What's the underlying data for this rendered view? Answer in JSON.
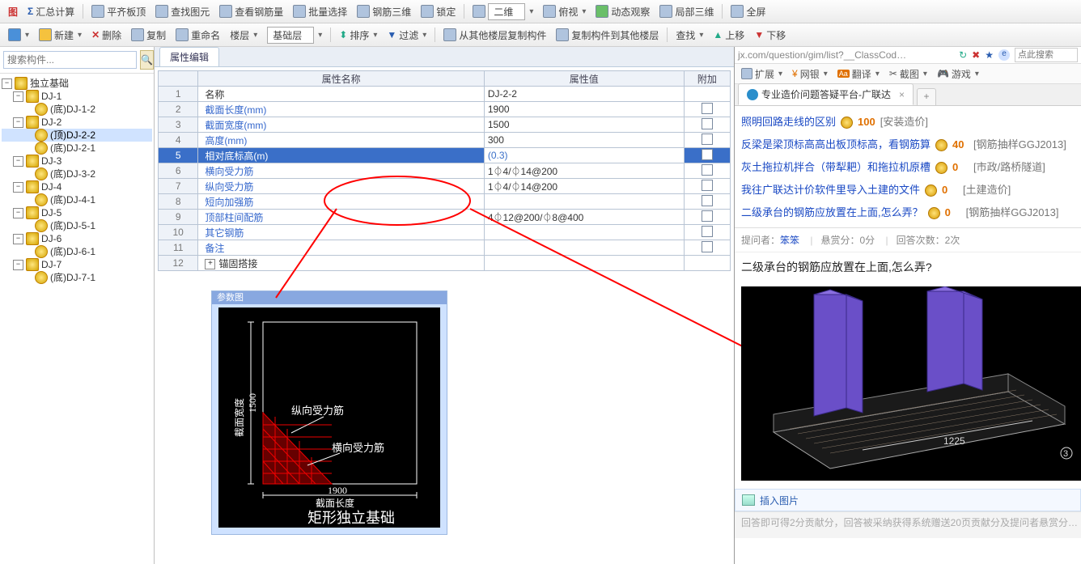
{
  "tb1": {
    "sum": "汇总计算",
    "flat": "平齐板顶",
    "findel": "查找图元",
    "rebar": "查看钢筋量",
    "batch": "批量选择",
    "r3d": "钢筋三维",
    "lock": "锁定",
    "view3d": "二维",
    "ortho": "俯视",
    "dyn": "动态观察",
    "local3d": "局部三维",
    "full": "全屏"
  },
  "tb2": {
    "new": "新建",
    "del": "删除",
    "copy": "复制",
    "ren": "重命名",
    "floor": "楼层",
    "layer": "基础层",
    "sort": "排序",
    "filter": "过滤",
    "copyfrom": "从其他楼层复制构件",
    "copyto": "复制构件到其他楼层",
    "find": "查找",
    "up": "上移",
    "down": "下移"
  },
  "search_ph": "搜索构件...",
  "tree": {
    "root": "独立基础",
    "n": [
      "DJ-1",
      "(底)DJ-1-2",
      "DJ-2",
      "(顶)DJ-2-2",
      "(底)DJ-2-1",
      "DJ-3",
      "(底)DJ-3-2",
      "DJ-4",
      "(底)DJ-4-1",
      "DJ-5",
      "(底)DJ-5-1",
      "DJ-6",
      "(底)DJ-6-1",
      "DJ-7",
      "(底)DJ-7-1"
    ]
  },
  "tab": "属性编辑",
  "th": {
    "name": "属性名称",
    "val": "属性值",
    "add": "附加"
  },
  "rows": [
    {
      "n": "名称",
      "v": "DJ-2-2",
      "b": 1
    },
    {
      "n": "截面长度(mm)",
      "v": "1900"
    },
    {
      "n": "截面宽度(mm)",
      "v": "1500"
    },
    {
      "n": "高度(mm)",
      "v": "300"
    },
    {
      "n": "相对底标高(m)",
      "v": "(0.3)",
      "sel": 1
    },
    {
      "n": "横向受力筋",
      "v": "1⏀4/⏀14@200"
    },
    {
      "n": "纵向受力筋",
      "v": "1⏀4/⏀14@200"
    },
    {
      "n": "短向加强筋",
      "v": ""
    },
    {
      "n": "顶部柱间配筋",
      "v": "4⏀12@200/⏀8@400"
    },
    {
      "n": "其它钢筋",
      "v": ""
    },
    {
      "n": "备注",
      "v": ""
    },
    {
      "n": "锚固搭接",
      "v": "",
      "exp": 1,
      "b": 1
    }
  ],
  "diag": {
    "title": "参数图",
    "vlabel": "截面宽度",
    "vdim": "1500",
    "hlabel": "截面长度",
    "hdim": "1900",
    "l1": "纵向受力筋",
    "l2": "横向受力筋",
    "caption": "矩形独立基础"
  },
  "url": "jx.com/question/gim/list?__ClassCod…",
  "ext": {
    "ext": "扩展",
    "bank": "网银",
    "trans": "翻译",
    "shot": "截图",
    "game": "游戏"
  },
  "rtab": "专业造价问题答疑平台-广联达",
  "qa": [
    {
      "t": "照明回路走线的区别",
      "p": "100",
      "g": "[安装造价]"
    },
    {
      "t": "反梁是梁顶标高高出板顶标高，看钢筋算",
      "p": "40",
      "g": "[钢筋抽样GGJ2013]"
    },
    {
      "t": "灰土拖拉机拌合（带犁耙）和拖拉机原槽",
      "p": "0",
      "g": "[市政/路桥隧道]"
    },
    {
      "t": "我往广联达计价软件里导入土建的文件",
      "p": "0",
      "g": "[土建造价]"
    },
    {
      "t": "二级承台的钢筋应放置在上面,怎么弄？",
      "p": "0",
      "g": "[钢筋抽样GGJ2013]"
    }
  ],
  "meta": {
    "asker_l": "提问者：",
    "asker": "笨笨",
    "bounty": "悬赏分：0分",
    "answers": "回答次数：2次"
  },
  "qtitle": "二级承台的钢筋应放置在上面,怎么弄?",
  "dim3d": "1225",
  "insert": "插入图片",
  "hint": "回答即可得2分贡献分，回答被采纳获得系统赠送20页贡献分及提问者悬赏分…",
  "searchbox_ph": "点此搜索"
}
